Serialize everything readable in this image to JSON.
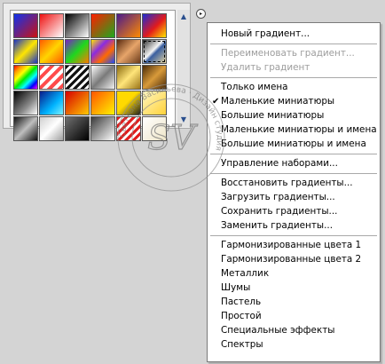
{
  "picker": {
    "swatches": [
      {
        "name": "foreground-to-background",
        "css": "linear-gradient(135deg,#1133ee 0%,#cc1111 100%)"
      },
      {
        "name": "foreground-to-transparent",
        "css": "linear-gradient(135deg,#ee1111 0%,#ffffff 100%)"
      },
      {
        "name": "black-white",
        "css": "linear-gradient(135deg,#000000 0%,#ffffff 100%)"
      },
      {
        "name": "red-green",
        "css": "linear-gradient(135deg,#ff1e00 0%,#1ea81e 100%)"
      },
      {
        "name": "violet-orange",
        "css": "linear-gradient(135deg,#4b1a8c 0%,#ff8a00 100%)"
      },
      {
        "name": "blue-red-yellow",
        "css": "linear-gradient(135deg,#1a2bd6 0%,#e31b1b 55%,#ffe600 100%)"
      },
      {
        "name": "blue-yellow-blue",
        "css": "linear-gradient(135deg,#1a34c8 0%,#ffe600 50%,#1a34c8 100%)"
      },
      {
        "name": "orange-yellow-orange",
        "css": "linear-gradient(135deg,#ff5a00 0%,#ffd500 50%,#ff5a00 100%)"
      },
      {
        "name": "violet-green-orange",
        "css": "linear-gradient(135deg,#7a1ec8 0%,#1ed81e 50%,#ff7a00 100%)"
      },
      {
        "name": "yellow-violet-orange-blue",
        "css": "linear-gradient(135deg,#ffe600 0%,#8a2be2 35%,#ff6a00 65%,#1a4bff 100%)"
      },
      {
        "name": "copper",
        "css": "linear-gradient(135deg,#5a2a10 0%,#e7a56a 50%,#6a3a1a 100%)"
      },
      {
        "name": "chrome",
        "css": "linear-gradient(135deg,#2a2a2a 0%,#f5f5f5 45%,#3a5fa0 55%,#e8d6a0 100%)"
      },
      {
        "name": "spectrum",
        "css": "linear-gradient(135deg,#ff0000,#ff9900,#ffff00,#00ee00,#00ffff,#0000ff,#ff00ff)"
      },
      {
        "name": "transparent-rainbow",
        "css": "repeating-linear-gradient(135deg,#ff4b4b 0 4px,#ffffff 4px 8px)"
      },
      {
        "name": "transparent-stripes",
        "css": "repeating-linear-gradient(135deg,#111111 0 3px,#ffffff 3px 6px)"
      },
      {
        "name": "silver",
        "css": "linear-gradient(135deg,#ffffff 0%,#7a7a7a 50%,#f0f0f0 100%)"
      },
      {
        "name": "gold",
        "css": "linear-gradient(135deg,#8a6a10 0%,#ffe57a 50%,#9a7418 100%)"
      },
      {
        "name": "bronze",
        "css": "linear-gradient(135deg,#4a2a08 0%,#d89a3a 50%,#4a2a08 100%)"
      },
      {
        "name": "neutral-density",
        "css": "linear-gradient(135deg,#000000 0%,#888888 60%,#ffffff 100%)"
      },
      {
        "name": "blue-cyan",
        "css": "linear-gradient(135deg,#0a1a8a 0%,#00b4ff 60%,#7ef0ff 100%)"
      },
      {
        "name": "red-yellow",
        "css": "linear-gradient(135deg,#d70000 0%,#ffc800 100%)"
      },
      {
        "name": "orange-yellow",
        "css": "linear-gradient(135deg,#ff5500 0%,#fff200 100%)"
      },
      {
        "name": "yellow-black",
        "css": "linear-gradient(135deg,#ffd900 0%,#ffd900 45%,#222222 100%)"
      },
      {
        "name": "pale-yellow",
        "css": "linear-gradient(135deg,#fff6c0 0%,#ffd23a 100%)"
      },
      {
        "name": "dark-chrome",
        "css": "linear-gradient(135deg,#111111 0%,#bfbfbf 50%,#111111 100%)"
      },
      {
        "name": "silver-white",
        "css": "linear-gradient(135deg,#cfcfcf 0%,#ffffff 50%,#9f9f9f 100%)"
      },
      {
        "name": "gray-black",
        "css": "linear-gradient(135deg,#6f6f6f 0%,#000000 100%)"
      },
      {
        "name": "gray-white",
        "css": "linear-gradient(135deg,#3a3a3a 0%,#ffffff 100%)"
      },
      {
        "name": "red-stripes",
        "css": "repeating-linear-gradient(135deg,#e01e1e 0 3px,#ffffff 3px 6px)"
      },
      {
        "name": "white-cream",
        "css": "linear-gradient(135deg,#ffffff 0%,#efe6c8 100%)"
      }
    ],
    "selected_index": 11,
    "menu_button_glyph": "▸"
  },
  "scrollbar": {
    "up_glyph": "▲",
    "down_glyph": "▼"
  },
  "menu": {
    "check_glyph": "✔",
    "items": [
      {
        "label": "Новый градиент...",
        "disabled": false,
        "checked": false
      },
      {
        "separator": true
      },
      {
        "label": "Переименовать градиент...",
        "disabled": true,
        "checked": false
      },
      {
        "label": "Удалить градиент",
        "disabled": true,
        "checked": false
      },
      {
        "separator": true
      },
      {
        "label": "Только имена",
        "disabled": false,
        "checked": false
      },
      {
        "label": "Маленькие миниатюры",
        "disabled": false,
        "checked": true
      },
      {
        "label": "Большие миниатюры",
        "disabled": false,
        "checked": false
      },
      {
        "label": "Маленькие миниатюры и имена",
        "disabled": false,
        "checked": false
      },
      {
        "label": "Большие миниатюры и имена",
        "disabled": false,
        "checked": false
      },
      {
        "separator": true
      },
      {
        "label": "Управление наборами...",
        "disabled": false,
        "checked": false
      },
      {
        "separator": true
      },
      {
        "label": "Восстановить градиенты...",
        "disabled": false,
        "checked": false
      },
      {
        "label": "Загрузить градиенты...",
        "disabled": false,
        "checked": false
      },
      {
        "label": "Сохранить градиенты...",
        "disabled": false,
        "checked": false
      },
      {
        "label": "Заменить градиенты...",
        "disabled": false,
        "checked": false
      },
      {
        "separator": true
      },
      {
        "label": "Гармонизированные цвета 1",
        "disabled": false,
        "checked": false
      },
      {
        "label": "Гармонизированные цвета 2",
        "disabled": false,
        "checked": false
      },
      {
        "label": "Металлик",
        "disabled": false,
        "checked": false
      },
      {
        "label": "Шумы",
        "disabled": false,
        "checked": false
      },
      {
        "label": "Пастель",
        "disabled": false,
        "checked": false
      },
      {
        "label": "Простой",
        "disabled": false,
        "checked": false
      },
      {
        "label": "Специальные эффекты",
        "disabled": false,
        "checked": false
      },
      {
        "label": "Спектры",
        "disabled": false,
        "checked": false
      }
    ]
  },
  "watermark": {
    "text": "Светлана Васильева · Дизайн студия",
    "monogram": "SV"
  }
}
